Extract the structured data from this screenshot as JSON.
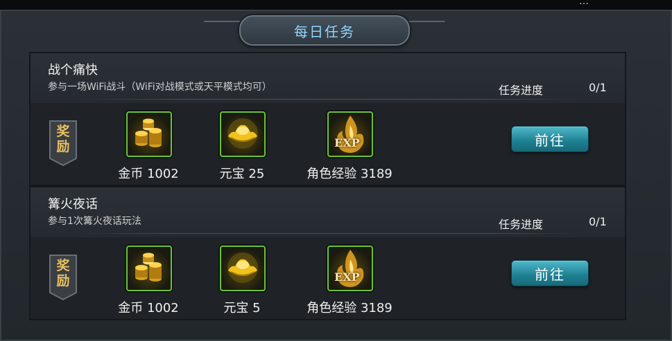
{
  "window": {
    "title": "每日任务",
    "top_partial_text": "…"
  },
  "tasks": [
    {
      "title": "战个痛快",
      "description": "参与一场WiFi战斗（WiFi对战模式或天平模式均可）",
      "progress_label": "任务进度",
      "progress_value": "0/1",
      "reward_label": "奖励",
      "rewards": [
        {
          "icon": "gold-coins-icon",
          "label": "金币 1002"
        },
        {
          "icon": "yuanbao-ingot-icon",
          "label": "元宝 25"
        },
        {
          "icon": "exp-icon",
          "label": "角色经验 3189"
        }
      ],
      "action_label": "前往"
    },
    {
      "title": "篝火夜话",
      "description": "参与1次篝火夜话玩法",
      "progress_label": "任务进度",
      "progress_value": "0/1",
      "reward_label": "奖励",
      "rewards": [
        {
          "icon": "gold-coins-icon",
          "label": "金币 1002"
        },
        {
          "icon": "yuanbao-ingot-icon",
          "label": "元宝 5"
        },
        {
          "icon": "exp-icon",
          "label": "角色经验 3189"
        }
      ],
      "action_label": "前往"
    }
  ],
  "icons": {
    "exp_text": "EXP"
  },
  "colors": {
    "title_accent": "#8fd4ff",
    "button": "#1d7f91",
    "reward_badge": "#e7c060",
    "icon_border": "#6cbf3a"
  }
}
